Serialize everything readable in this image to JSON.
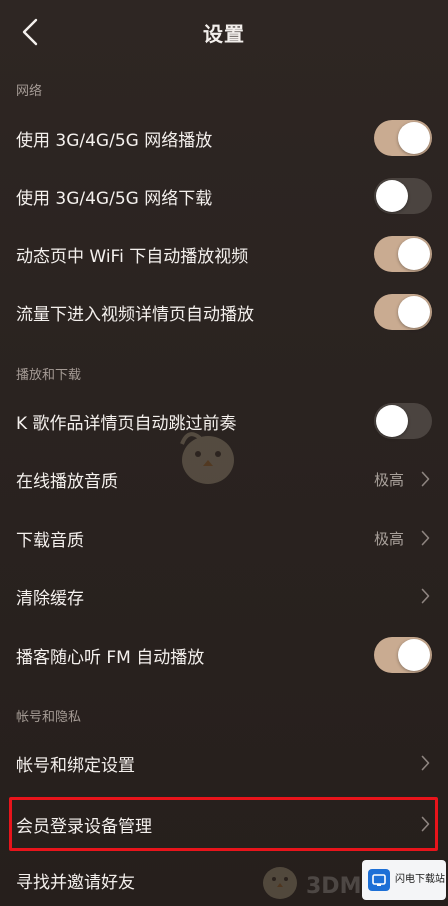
{
  "header": {
    "title": "设置"
  },
  "sections": {
    "network": {
      "title": "网络"
    },
    "playback": {
      "title": "播放和下载"
    },
    "account": {
      "title": "帐号和隐私"
    }
  },
  "rows": {
    "play_cellular": {
      "label": "使用 3G/4G/5G 网络播放",
      "toggle": "on"
    },
    "download_cellular": {
      "label": "使用 3G/4G/5G 网络下载",
      "toggle": "off"
    },
    "feed_autoplay_wifi": {
      "label": "动态页中 WiFi 下自动播放视频",
      "toggle": "on"
    },
    "cellular_video_autoplay": {
      "label": "流量下进入视频详情页自动播放",
      "toggle": "on"
    },
    "k_song_skip_intro": {
      "label": "K 歌作品详情页自动跳过前奏",
      "toggle": "off"
    },
    "online_quality": {
      "label": "在线播放音质",
      "value": "极高"
    },
    "download_quality": {
      "label": "下载音质",
      "value": "极高"
    },
    "clear_cache": {
      "label": "清除缓存"
    },
    "podcast_fm_autoplay": {
      "label": "播客随心听 FM 自动播放",
      "toggle": "on"
    },
    "account_binding": {
      "label": "帐号和绑定设置"
    },
    "member_device_mgmt": {
      "label": "会员登录设备管理"
    },
    "find_invite_friends": {
      "label": "寻找并邀请好友"
    }
  },
  "watermark": {
    "text": "3DM",
    "badge_title": "闪电下载站"
  },
  "colors": {
    "background": "#2b2420",
    "toggle_on": "#c9ab91",
    "toggle_off": "#4b4440",
    "highlight": "#e8141b"
  }
}
